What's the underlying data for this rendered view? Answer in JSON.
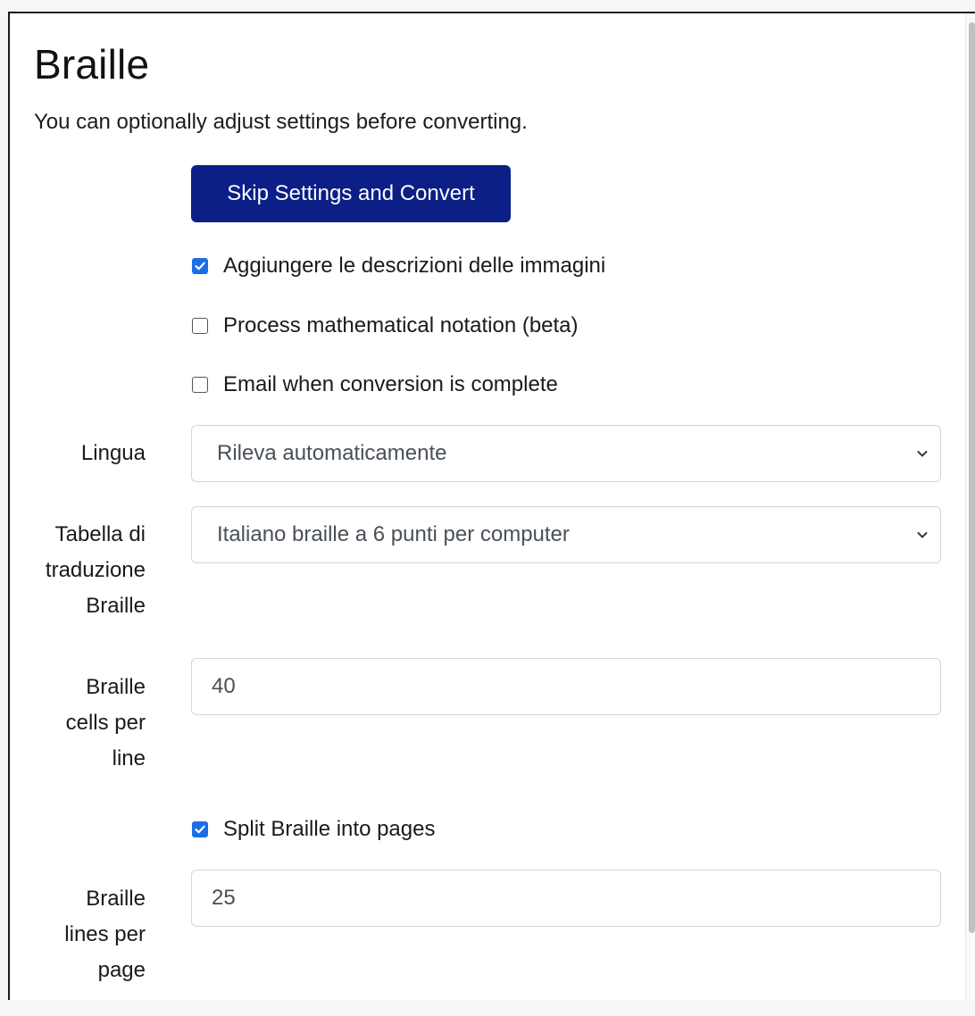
{
  "page": {
    "title": "Braille",
    "subtitle": "You can optionally adjust settings before converting."
  },
  "actions": {
    "skip_convert_label": "Skip Settings and Convert"
  },
  "options": {
    "image_descriptions": {
      "label": "Aggiungere le descrizioni delle immagini",
      "checked": true
    },
    "math_notation": {
      "label": "Process mathematical notation (beta)",
      "checked": false
    },
    "email_notify": {
      "label": "Email when conversion is complete",
      "checked": false
    },
    "split_pages": {
      "label": "Split Braille into pages",
      "checked": true
    }
  },
  "fields": {
    "language": {
      "label": "Lingua",
      "value": "Rileva automaticamente"
    },
    "table": {
      "label_lines": [
        "Tabella di",
        "traduzione",
        "Braille"
      ],
      "value": "Italiano braille a 6 punti per computer"
    },
    "cells": {
      "label_lines": [
        "Braille",
        "cells per",
        "line"
      ],
      "value": "40"
    },
    "lines": {
      "label_lines": [
        "Braille",
        "lines per",
        "page"
      ],
      "value": "25"
    }
  },
  "icons": {
    "select_chevron": "chevron-down-icon",
    "check": "check-icon"
  },
  "colors": {
    "primary": "#0b1f87",
    "checkbox_checked": "#1a6ee8"
  }
}
